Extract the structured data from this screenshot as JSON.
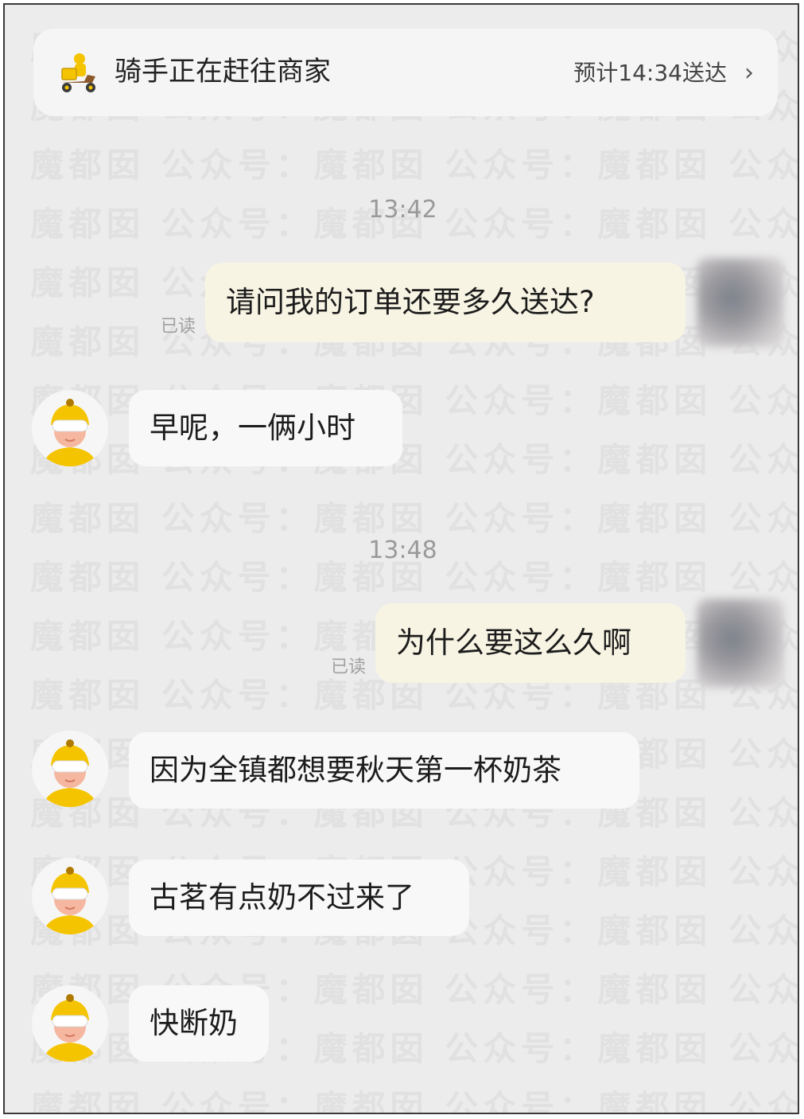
{
  "banner": {
    "status_text": "骑手正在赶往商家",
    "eta_text": "预计14:34送达",
    "chevron_icon": "chevron-right-icon",
    "rider_icon": "delivery-scooter-icon"
  },
  "watermark_text": "公众号：魔都囡",
  "read_label": "已读",
  "messages": [
    {
      "type": "timestamp",
      "text": "13:42"
    },
    {
      "type": "sent",
      "text": "请问我的订单还要多久送达?"
    },
    {
      "type": "received",
      "text": "早呢，一俩小时"
    },
    {
      "type": "timestamp",
      "text": "13:48"
    },
    {
      "type": "sent",
      "text": "为什么要这么久啊"
    },
    {
      "type": "received",
      "text": "因为全镇都想要秋天第一杯奶茶"
    },
    {
      "type": "received",
      "text": "古茗有点奶不过来了"
    },
    {
      "type": "received",
      "text": "快断奶"
    }
  ],
  "colors": {
    "background": "#ececec",
    "sent_bubble": "#f7f4e4",
    "received_bubble": "#f8f8f8",
    "rider_yellow": "#f5c400"
  }
}
